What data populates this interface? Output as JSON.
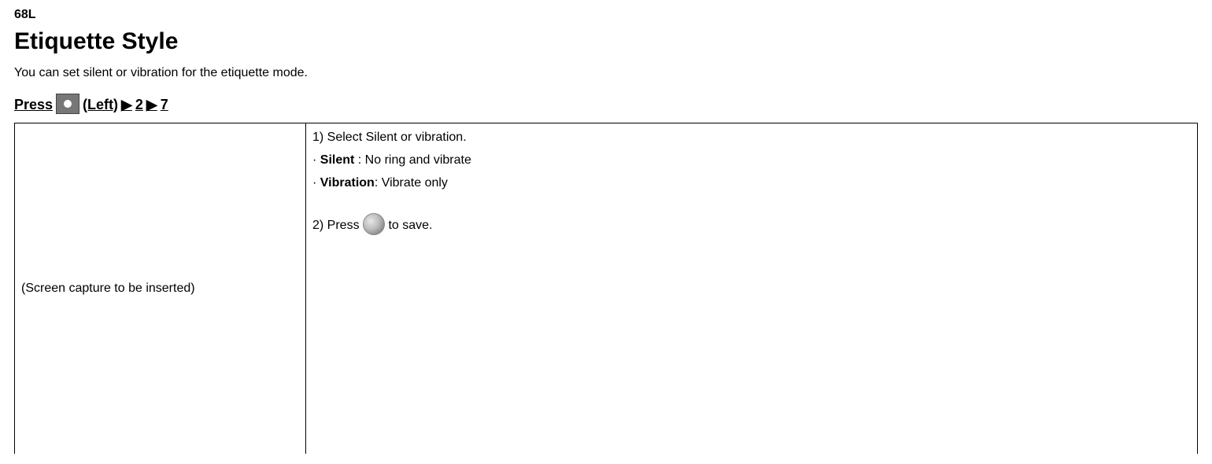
{
  "page_number": "68L",
  "title": "Etiquette Style",
  "intro": "You can set silent or vibration for the etiquette mode.",
  "press_line": {
    "prefix": "Press  ",
    "left_label": "(Left)",
    "arrow": "▶",
    "num1": "2",
    "num2": "7"
  },
  "left_cell": "(Screen capture to be inserted)",
  "right_cell": {
    "step1": "1) Select Silent or vibration.",
    "bullet1": {
      "dot": "· ",
      "label": "Silent",
      "rest": " : No ring and vibrate"
    },
    "bullet2": {
      "dot": "· ",
      "label": "Vibration",
      "rest": ": Vibrate only"
    },
    "step2_prefix": "2) Press  ",
    "step2_suffix": "  to save."
  }
}
